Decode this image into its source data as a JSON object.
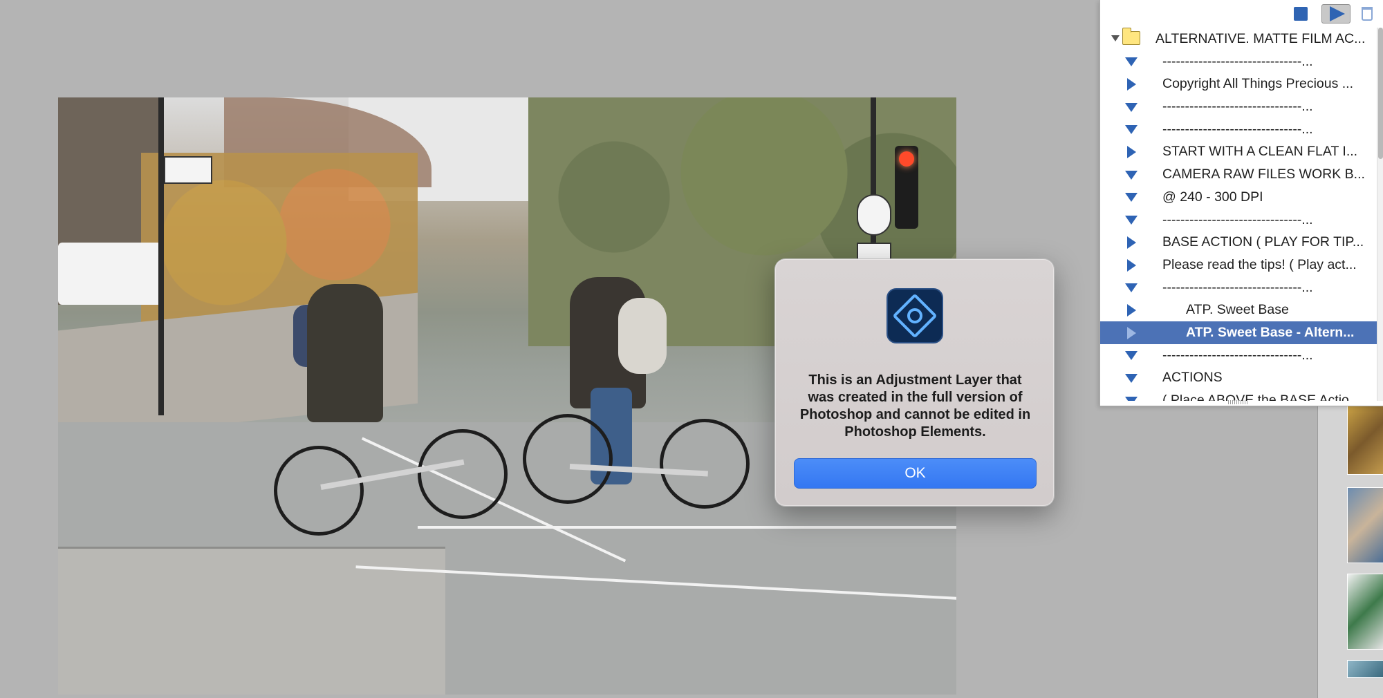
{
  "actions_panel": {
    "toolbar": {
      "stop_icon": "stop-icon",
      "play_icon": "play-icon",
      "trash_icon": "trash-icon"
    },
    "folder": {
      "label": "ALTERNATIVE. MATTE FILM AC..."
    },
    "items": [
      {
        "label": "-------------------------------...",
        "toggle": "down",
        "indent": false,
        "selected": false
      },
      {
        "label": "Copyright All Things Precious ...",
        "toggle": "right",
        "indent": false,
        "selected": false
      },
      {
        "label": "-------------------------------...",
        "toggle": "down",
        "indent": false,
        "selected": false
      },
      {
        "label": "-------------------------------...",
        "toggle": "down",
        "indent": false,
        "selected": false
      },
      {
        "label": "START WITH A CLEAN FLAT I...",
        "toggle": "right",
        "indent": false,
        "selected": false
      },
      {
        "label": "CAMERA RAW FILES WORK B...",
        "toggle": "down",
        "indent": false,
        "selected": false
      },
      {
        "label": "@ 240 - 300 DPI",
        "toggle": "down",
        "indent": false,
        "selected": false
      },
      {
        "label": "-------------------------------...",
        "toggle": "down",
        "indent": false,
        "selected": false
      },
      {
        "label": "BASE ACTION ( PLAY FOR TIP...",
        "toggle": "right",
        "indent": false,
        "selected": false
      },
      {
        "label": "Please read the tips! ( Play act...",
        "toggle": "right",
        "indent": false,
        "selected": false
      },
      {
        "label": "-------------------------------...",
        "toggle": "down",
        "indent": false,
        "selected": false
      },
      {
        "label": "ATP. Sweet Base",
        "toggle": "right",
        "indent": true,
        "selected": false
      },
      {
        "label": "ATP. Sweet Base - Altern...",
        "toggle": "right",
        "indent": true,
        "selected": true
      },
      {
        "label": "-------------------------------...",
        "toggle": "down",
        "indent": false,
        "selected": false
      },
      {
        "label": "ACTIONS",
        "toggle": "down",
        "indent": false,
        "selected": false
      },
      {
        "label": "( Place ABOVE the BASE Actio...",
        "toggle": "down",
        "indent": false,
        "selected": false
      }
    ]
  },
  "dialog": {
    "app_icon": "photoshop-elements-icon",
    "message": "This is an Adjustment Layer that was created in the full version of Photoshop and cannot be edited in Photoshop Elements.",
    "ok_label": "OK"
  },
  "colors": {
    "accent": "#3477f2",
    "selection": "#4c72b6",
    "canvas_bg": "#b4b4b4"
  }
}
